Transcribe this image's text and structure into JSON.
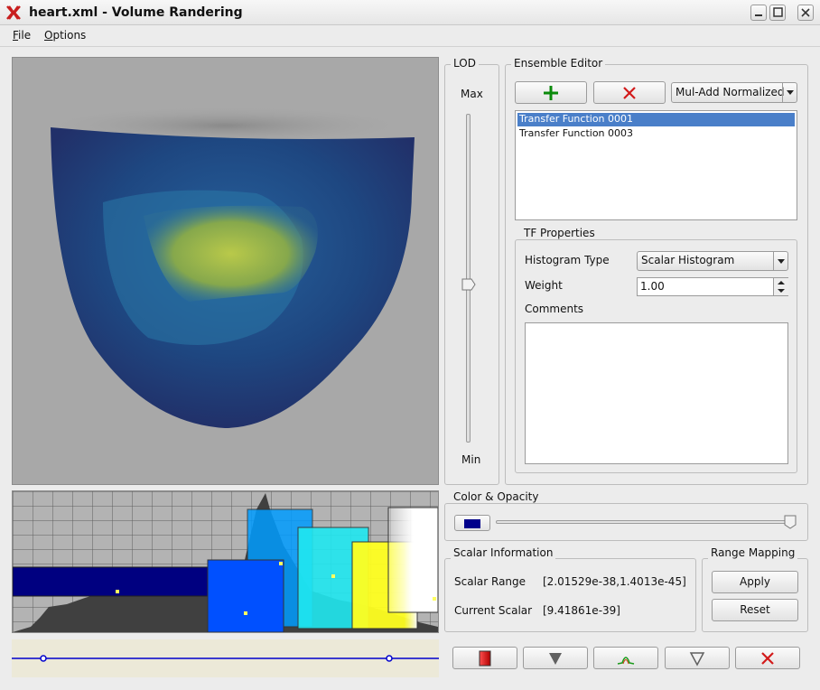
{
  "window": {
    "title": "heart.xml - Volume Randering"
  },
  "menu": {
    "file": "File",
    "options": "Options"
  },
  "lod": {
    "title": "LOD",
    "max": "Max",
    "min": "Min",
    "level": 0.5
  },
  "ensemble": {
    "title": "Ensemble Editor",
    "mode": "Mul-Add Normalized",
    "items": [
      "Transfer Function 0001",
      "Transfer Function 0003"
    ],
    "selected_index": 0
  },
  "tf": {
    "title": "TF Properties",
    "histogram_label": "Histogram Type",
    "histogram_value": "Scalar Histogram",
    "weight_label": "Weight",
    "weight_value": "1.00",
    "comments_label": "Comments",
    "comments_value": ""
  },
  "color_opacity": {
    "title": "Color & Opacity",
    "opacity": 0.98,
    "swatch": "#00008b"
  },
  "scalar": {
    "title": "Scalar Information",
    "range_label": "Scalar Range",
    "range_value": "[2.01529e-38,1.4013e-45]",
    "current_label": "Current Scalar",
    "current_value": "[9.41861e-39]"
  },
  "range_mapping": {
    "title": "Range Mapping",
    "apply": "Apply",
    "reset": "Reset"
  },
  "icons": {
    "add": "plus-icon",
    "remove": "close-icon",
    "color": "color-swatch-icon",
    "down1": "triangle-down-icon",
    "gauss": "gaussian-icon",
    "down2": "triangle-down-icon",
    "delete": "close-icon"
  }
}
